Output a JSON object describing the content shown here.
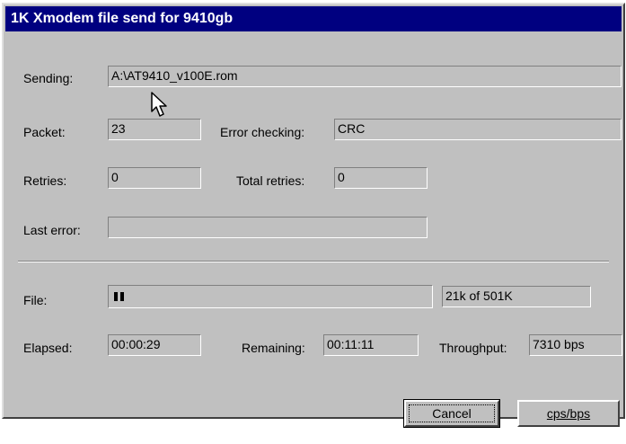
{
  "window": {
    "title": "1K Xmodem file send for 9410gb"
  },
  "fields": {
    "sending_label": "Sending:",
    "sending_value": "A:\\AT9410_v100E.rom",
    "packet_label": "Packet:",
    "packet_value": "23",
    "error_checking_label": "Error checking:",
    "error_checking_value": "CRC",
    "retries_label": "Retries:",
    "retries_value": "0",
    "total_retries_label": "Total retries:",
    "total_retries_value": "0",
    "last_error_label": "Last error:",
    "last_error_value": ""
  },
  "progress": {
    "file_label": "File:",
    "file_progress_fraction": 0.042,
    "file_size_text": "21k of 501K",
    "elapsed_label": "Elapsed:",
    "elapsed_value": "00:00:29",
    "remaining_label": "Remaining:",
    "remaining_value": "00:11:11",
    "throughput_label": "Throughput:",
    "throughput_value": "7310 bps"
  },
  "buttons": {
    "cancel_label": "Cancel",
    "cps_bps_label": "cps/bps"
  },
  "colors": {
    "titlebar": "#000080",
    "dialog_face": "#c0c0c0"
  }
}
